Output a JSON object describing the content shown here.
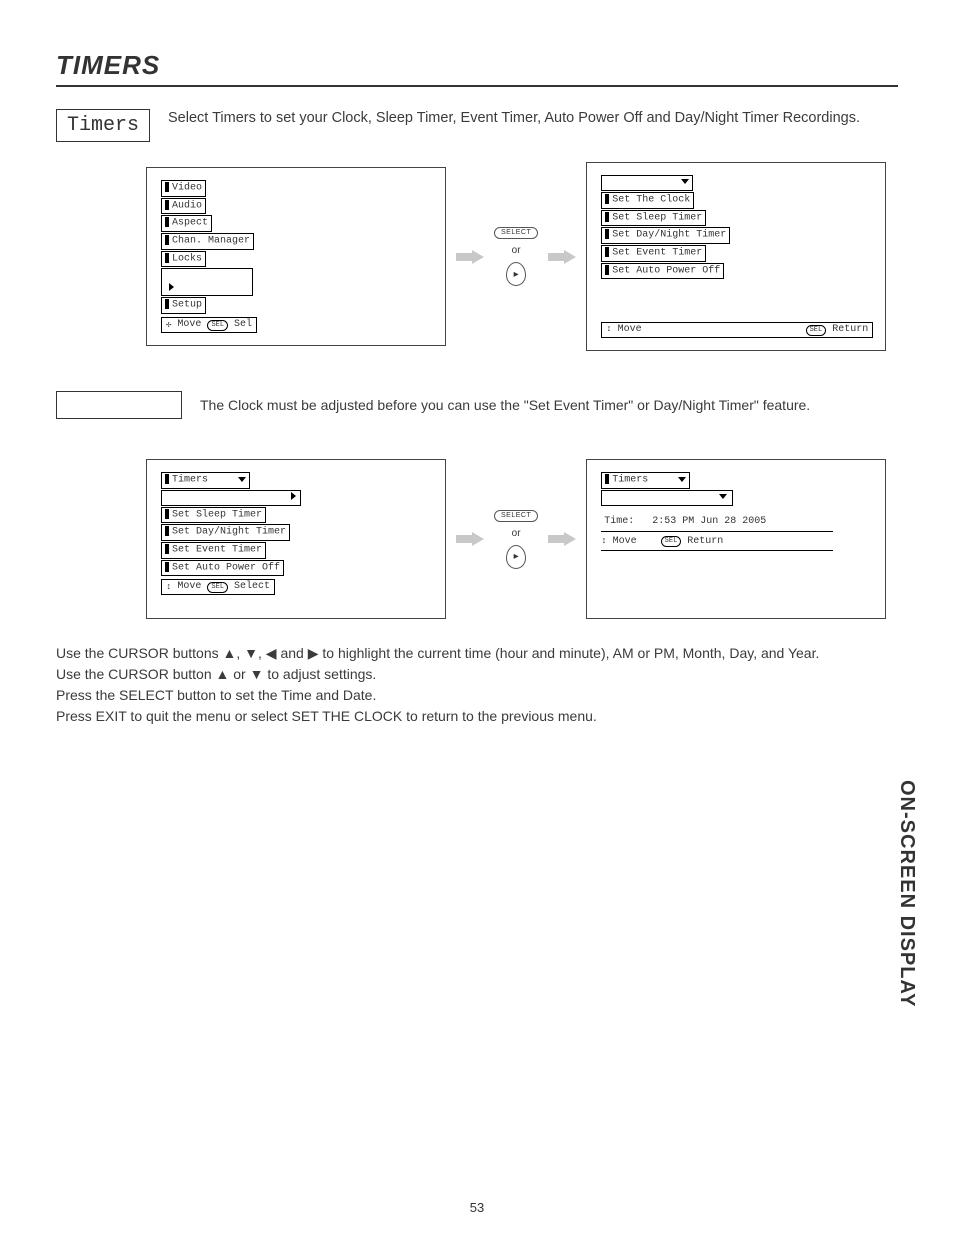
{
  "title": "TIMERS",
  "intro": {
    "label": "Timers",
    "text": "Select Timers to set your Clock, Sleep Timer, Event Timer, Auto Power Off and Day/Night Timer Recordings."
  },
  "diagram1": {
    "left": {
      "items": [
        "Video",
        "Audio",
        "Aspect",
        "Chan. Manager",
        "Locks"
      ],
      "highlighted": "",
      "more_items": [
        "Setup"
      ],
      "footer_move": "Move",
      "footer_sel": "Sel"
    },
    "mid": {
      "select": "SELECT",
      "or": "or"
    },
    "right": {
      "items": [
        "Set The Clock",
        "Set Sleep Timer",
        "Set Day/Night Timer",
        "Set Event Timer",
        "Set Auto Power Off"
      ],
      "footer_move": "Move",
      "footer_return": "Return"
    }
  },
  "note": {
    "label": "",
    "text": "The Clock must be adjusted before you can use the \"Set Event Timer\" or Day/Night Timer\" feature."
  },
  "diagram2": {
    "left": {
      "header": "Timers",
      "items": [
        "Set Sleep Timer",
        "Set Day/Night Timer",
        "Set Event Timer",
        "Set Auto Power Off"
      ],
      "footer_move": "Move",
      "footer_select": "Select"
    },
    "mid": {
      "select": "SELECT",
      "or": "or"
    },
    "right": {
      "header": "Timers",
      "time_label": "Time:",
      "time_value": "2:53 PM Jun 28 2005",
      "footer_move": "Move",
      "footer_return": "Return"
    }
  },
  "instructions": {
    "l1a": "Use the CURSOR buttons ",
    "l1b": " and ",
    "l1c": " to highlight the current time (hour and minute), AM or PM, Month, Day, and Year.",
    "l2a": "Use the CURSOR button ",
    "l2b": " or ",
    "l2c": " to adjust settings.",
    "l3": "Press the SELECT button to set the Time and Date.",
    "l4": "Press EXIT to quit the menu or select SET THE CLOCK to return to the previous menu."
  },
  "side_label": "ON-SCREEN DISPLAY",
  "page_number": "53"
}
